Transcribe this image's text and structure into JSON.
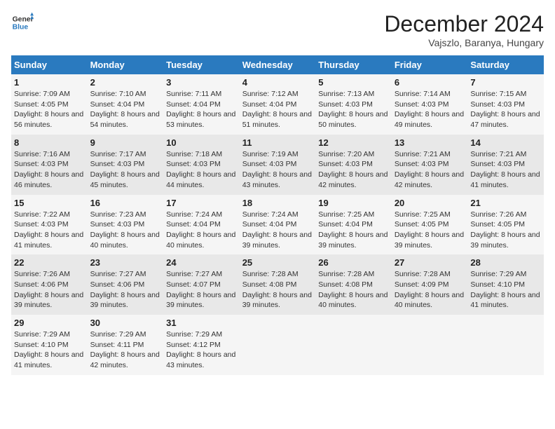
{
  "header": {
    "logo_general": "General",
    "logo_blue": "Blue",
    "title": "December 2024",
    "subtitle": "Vajszlo, Baranya, Hungary"
  },
  "weekdays": [
    "Sunday",
    "Monday",
    "Tuesday",
    "Wednesday",
    "Thursday",
    "Friday",
    "Saturday"
  ],
  "weeks": [
    [
      {
        "day": "1",
        "sunrise": "Sunrise: 7:09 AM",
        "sunset": "Sunset: 4:05 PM",
        "daylight": "Daylight: 8 hours and 56 minutes."
      },
      {
        "day": "2",
        "sunrise": "Sunrise: 7:10 AM",
        "sunset": "Sunset: 4:04 PM",
        "daylight": "Daylight: 8 hours and 54 minutes."
      },
      {
        "day": "3",
        "sunrise": "Sunrise: 7:11 AM",
        "sunset": "Sunset: 4:04 PM",
        "daylight": "Daylight: 8 hours and 53 minutes."
      },
      {
        "day": "4",
        "sunrise": "Sunrise: 7:12 AM",
        "sunset": "Sunset: 4:04 PM",
        "daylight": "Daylight: 8 hours and 51 minutes."
      },
      {
        "day": "5",
        "sunrise": "Sunrise: 7:13 AM",
        "sunset": "Sunset: 4:03 PM",
        "daylight": "Daylight: 8 hours and 50 minutes."
      },
      {
        "day": "6",
        "sunrise": "Sunrise: 7:14 AM",
        "sunset": "Sunset: 4:03 PM",
        "daylight": "Daylight: 8 hours and 49 minutes."
      },
      {
        "day": "7",
        "sunrise": "Sunrise: 7:15 AM",
        "sunset": "Sunset: 4:03 PM",
        "daylight": "Daylight: 8 hours and 47 minutes."
      }
    ],
    [
      {
        "day": "8",
        "sunrise": "Sunrise: 7:16 AM",
        "sunset": "Sunset: 4:03 PM",
        "daylight": "Daylight: 8 hours and 46 minutes."
      },
      {
        "day": "9",
        "sunrise": "Sunrise: 7:17 AM",
        "sunset": "Sunset: 4:03 PM",
        "daylight": "Daylight: 8 hours and 45 minutes."
      },
      {
        "day": "10",
        "sunrise": "Sunrise: 7:18 AM",
        "sunset": "Sunset: 4:03 PM",
        "daylight": "Daylight: 8 hours and 44 minutes."
      },
      {
        "day": "11",
        "sunrise": "Sunrise: 7:19 AM",
        "sunset": "Sunset: 4:03 PM",
        "daylight": "Daylight: 8 hours and 43 minutes."
      },
      {
        "day": "12",
        "sunrise": "Sunrise: 7:20 AM",
        "sunset": "Sunset: 4:03 PM",
        "daylight": "Daylight: 8 hours and 42 minutes."
      },
      {
        "day": "13",
        "sunrise": "Sunrise: 7:21 AM",
        "sunset": "Sunset: 4:03 PM",
        "daylight": "Daylight: 8 hours and 42 minutes."
      },
      {
        "day": "14",
        "sunrise": "Sunrise: 7:21 AM",
        "sunset": "Sunset: 4:03 PM",
        "daylight": "Daylight: 8 hours and 41 minutes."
      }
    ],
    [
      {
        "day": "15",
        "sunrise": "Sunrise: 7:22 AM",
        "sunset": "Sunset: 4:03 PM",
        "daylight": "Daylight: 8 hours and 41 minutes."
      },
      {
        "day": "16",
        "sunrise": "Sunrise: 7:23 AM",
        "sunset": "Sunset: 4:03 PM",
        "daylight": "Daylight: 8 hours and 40 minutes."
      },
      {
        "day": "17",
        "sunrise": "Sunrise: 7:24 AM",
        "sunset": "Sunset: 4:04 PM",
        "daylight": "Daylight: 8 hours and 40 minutes."
      },
      {
        "day": "18",
        "sunrise": "Sunrise: 7:24 AM",
        "sunset": "Sunset: 4:04 PM",
        "daylight": "Daylight: 8 hours and 39 minutes."
      },
      {
        "day": "19",
        "sunrise": "Sunrise: 7:25 AM",
        "sunset": "Sunset: 4:04 PM",
        "daylight": "Daylight: 8 hours and 39 minutes."
      },
      {
        "day": "20",
        "sunrise": "Sunrise: 7:25 AM",
        "sunset": "Sunset: 4:05 PM",
        "daylight": "Daylight: 8 hours and 39 minutes."
      },
      {
        "day": "21",
        "sunrise": "Sunrise: 7:26 AM",
        "sunset": "Sunset: 4:05 PM",
        "daylight": "Daylight: 8 hours and 39 minutes."
      }
    ],
    [
      {
        "day": "22",
        "sunrise": "Sunrise: 7:26 AM",
        "sunset": "Sunset: 4:06 PM",
        "daylight": "Daylight: 8 hours and 39 minutes."
      },
      {
        "day": "23",
        "sunrise": "Sunrise: 7:27 AM",
        "sunset": "Sunset: 4:06 PM",
        "daylight": "Daylight: 8 hours and 39 minutes."
      },
      {
        "day": "24",
        "sunrise": "Sunrise: 7:27 AM",
        "sunset": "Sunset: 4:07 PM",
        "daylight": "Daylight: 8 hours and 39 minutes."
      },
      {
        "day": "25",
        "sunrise": "Sunrise: 7:28 AM",
        "sunset": "Sunset: 4:08 PM",
        "daylight": "Daylight: 8 hours and 39 minutes."
      },
      {
        "day": "26",
        "sunrise": "Sunrise: 7:28 AM",
        "sunset": "Sunset: 4:08 PM",
        "daylight": "Daylight: 8 hours and 40 minutes."
      },
      {
        "day": "27",
        "sunrise": "Sunrise: 7:28 AM",
        "sunset": "Sunset: 4:09 PM",
        "daylight": "Daylight: 8 hours and 40 minutes."
      },
      {
        "day": "28",
        "sunrise": "Sunrise: 7:29 AM",
        "sunset": "Sunset: 4:10 PM",
        "daylight": "Daylight: 8 hours and 41 minutes."
      }
    ],
    [
      {
        "day": "29",
        "sunrise": "Sunrise: 7:29 AM",
        "sunset": "Sunset: 4:10 PM",
        "daylight": "Daylight: 8 hours and 41 minutes."
      },
      {
        "day": "30",
        "sunrise": "Sunrise: 7:29 AM",
        "sunset": "Sunset: 4:11 PM",
        "daylight": "Daylight: 8 hours and 42 minutes."
      },
      {
        "day": "31",
        "sunrise": "Sunrise: 7:29 AM",
        "sunset": "Sunset: 4:12 PM",
        "daylight": "Daylight: 8 hours and 43 minutes."
      },
      null,
      null,
      null,
      null
    ]
  ]
}
